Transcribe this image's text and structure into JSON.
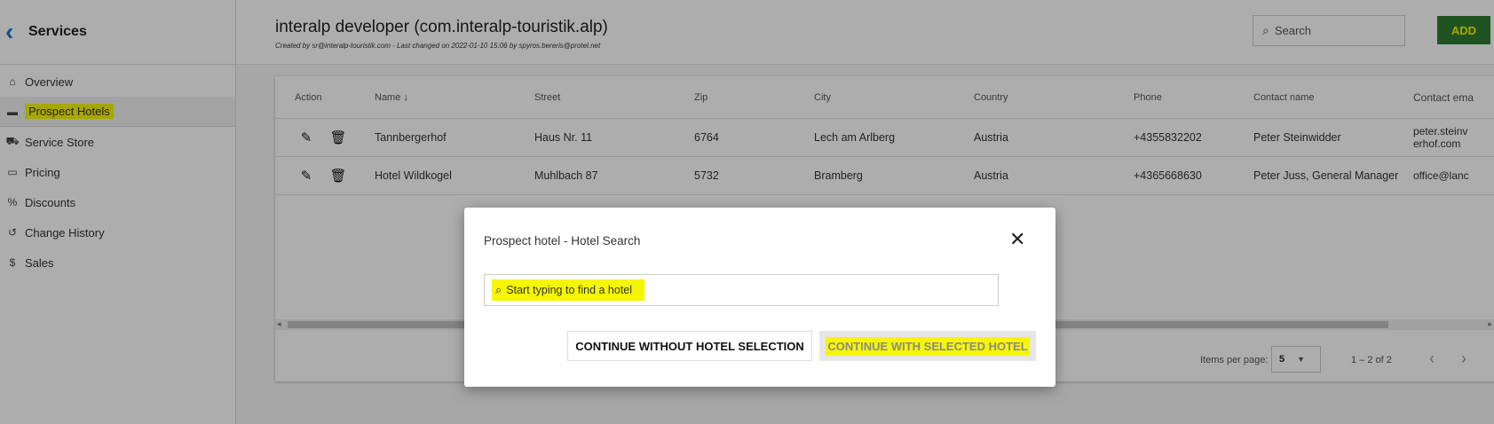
{
  "sidebar": {
    "title": "Services",
    "back_icon": "chevron-left-icon",
    "items": [
      {
        "label": "Overview",
        "icon": "home-icon"
      },
      {
        "label": "Prospect Hotels",
        "icon": "bed-icon"
      },
      {
        "label": "Service Store",
        "icon": "cart-icon"
      },
      {
        "label": "Pricing",
        "icon": "credit-card-icon"
      },
      {
        "label": "Discounts",
        "icon": "discount-icon"
      },
      {
        "label": "Change History",
        "icon": "history-icon"
      },
      {
        "label": "Sales",
        "icon": "dollar-icon"
      }
    ]
  },
  "header": {
    "title": "interalp developer (com.interalp-touristik.alp)",
    "subtitle": "Created by sr@interalp-touristik.com - Last changed on 2022-01-10 15:06 by spyros.bereris@protel.net",
    "search_placeholder": "Search",
    "add_label": "ADD"
  },
  "table": {
    "headers": {
      "action": "Action",
      "name": "Name",
      "sort_icon": "↓",
      "street": "Street",
      "zip": "Zip",
      "city": "City",
      "country": "Country",
      "phone": "Phone",
      "contact": "Contact name",
      "email": "Contact ema"
    },
    "rows": [
      {
        "name": "Tannbergerhof",
        "street": "Haus Nr. 11",
        "zip": "6764",
        "city": "Lech am Arlberg",
        "country": "Austria",
        "phone": "+4355832202",
        "contact": "Peter Steinwidder",
        "email_line1": "peter.steinv",
        "email_line2": "erhof.com"
      },
      {
        "name": "Hotel Wildkogel",
        "street": "Muhlbach 87",
        "zip": "5732",
        "city": "Bramberg",
        "country": "Austria",
        "phone": "+4365668630",
        "contact": "Peter Juss, General Manager",
        "email_line1": "office@lanc",
        "email_line2": ""
      }
    ]
  },
  "paginator": {
    "items_per_page_label": "Items per page:",
    "items_per_page": "5",
    "range": "1 – 2 of 2"
  },
  "dialog": {
    "title": "Prospect hotel - Hotel Search",
    "search_placeholder": "Start typing to find a hotel",
    "btn_without": "CONTINUE WITHOUT HOTEL SELECTION",
    "btn_with": "CONTINUE WITH SELECTED HOTEL"
  },
  "colors": {
    "highlight": "#f6f600",
    "accent": "#1976d2",
    "add_button": "#2e7d32"
  }
}
